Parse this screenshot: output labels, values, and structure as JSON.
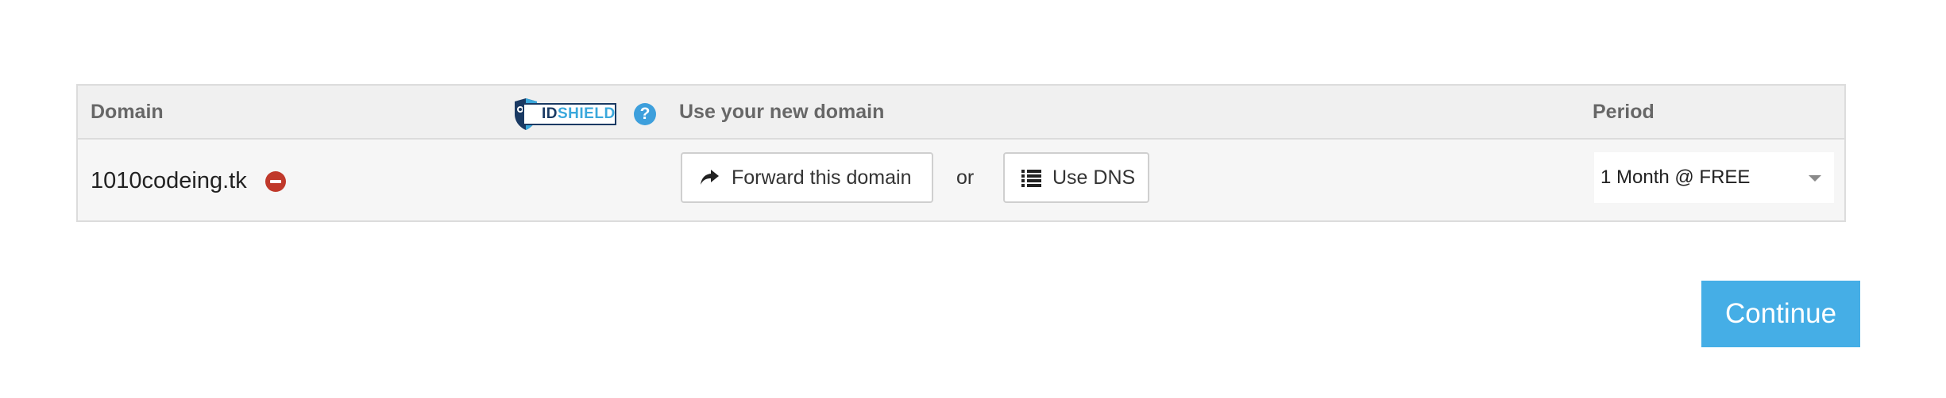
{
  "table": {
    "headers": {
      "domain": "Domain",
      "use": "Use your new domain",
      "period": "Period"
    },
    "idshield": {
      "text_id": "ID",
      "text_shield": "SHIELD",
      "icon": "id-shield-logo"
    },
    "help_icon": "?",
    "row": {
      "domain": "1010codeing.tk",
      "remove_icon": "minus-circle-icon",
      "forward_button": "Forward this domain",
      "or": "or",
      "dns_button": "Use DNS",
      "period_selected": "1 Month @ FREE"
    }
  },
  "continue_button": "Continue",
  "colors": {
    "accent": "#45aee6",
    "remove": "#c0392b",
    "help": "#3d9fdc",
    "idshield_navy": "#1a3a63",
    "idshield_blue": "#3aa8dc"
  }
}
